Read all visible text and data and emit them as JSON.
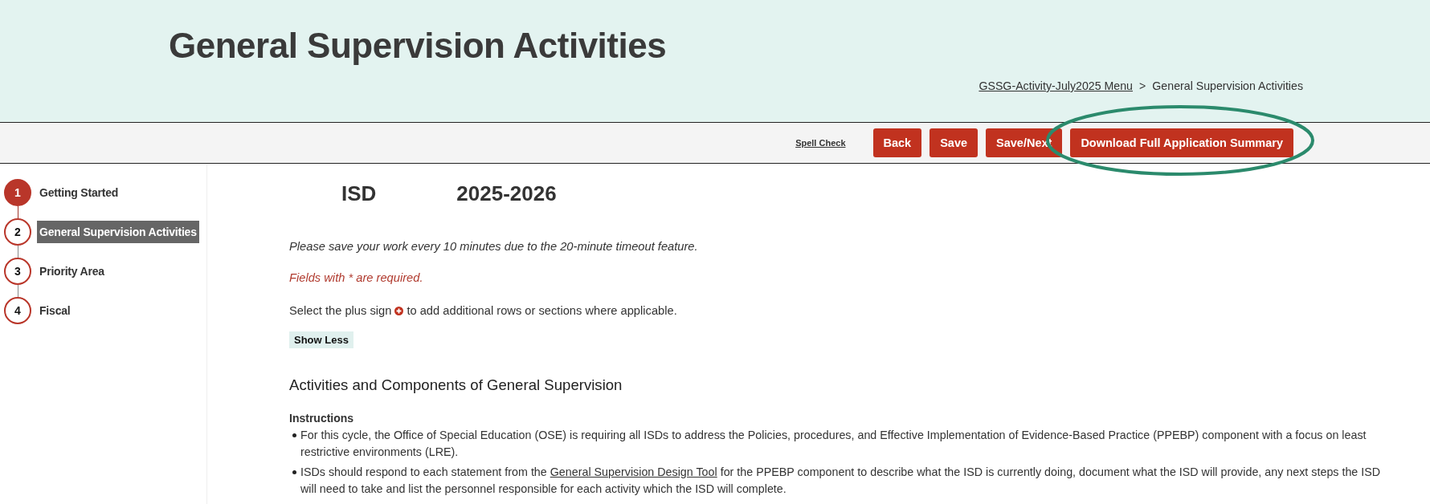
{
  "header": {
    "title": "General Supervision Activities",
    "breadcrumb": [
      {
        "kind": "link",
        "label": "GSSG-Activity-July2025 Menu"
      },
      {
        "kind": "separator",
        "label": ">"
      },
      {
        "kind": "current",
        "label": "General Supervision Activities"
      }
    ]
  },
  "toolbar": {
    "spell_check": "Spell Check",
    "buttons": [
      "Back",
      "Save",
      "Save/Next",
      "Download Full Application Summary"
    ]
  },
  "steps": [
    {
      "number": "1",
      "label": "Getting Started",
      "completed": true,
      "selected": false
    },
    {
      "number": "2",
      "label": "General Supervision Activities",
      "completed": false,
      "selected": true
    },
    {
      "number": "3",
      "label": "Priority Area",
      "completed": false,
      "selected": false
    },
    {
      "number": "4",
      "label": "Fiscal",
      "completed": false,
      "selected": false
    }
  ],
  "content": {
    "isd_label": "ISD",
    "year": "2025-2026",
    "save_notice": "Please save your work every 10 minutes due to the 20-minute timeout feature.",
    "required_notice": "Fields with * are required.",
    "plus_hint": {
      "before": "Select the plus sign",
      "after": "to add additional rows or sections where applicable."
    },
    "toggle_button": "Show Less",
    "section_title": "Activities and Components of General Supervision",
    "instructions_label": "Instructions",
    "instructions": [
      {
        "text": "For this cycle, the Office of Special Education (OSE) is requiring all ISDs to address the Policies, procedures, and Effective Implementation of Evidence-Based Practice (PPEBP) component with a focus on least restrictive environments (LRE)."
      },
      {
        "text": "ISDs should respond to each statement from the",
        "link": "General Supervision Design Tool",
        "after": "for the PPEBP component to describe what the ISD is currently doing, document what the ISD will provide, any next steps the ISD will need to take and list the personnel responsible for each activity which the ISD will complete."
      }
    ]
  }
}
